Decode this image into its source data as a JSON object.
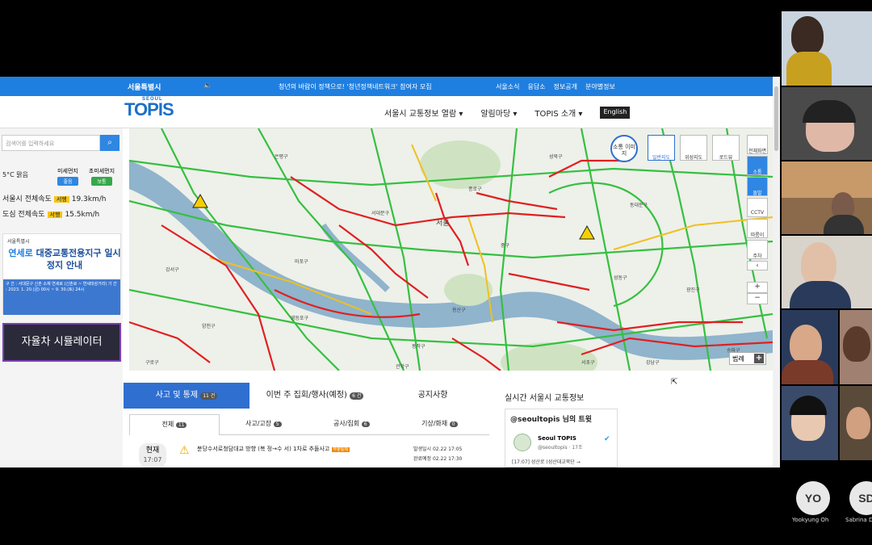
{
  "browser": {
    "topbar": {
      "logo": "서울특별시",
      "notice": "청년의 바람이 정책으로! '청년정책네트워크' 참여자 모집",
      "links": [
        "서울소식",
        "응답소",
        "정보공개",
        "분야별정보"
      ]
    },
    "nav": {
      "brand": "TOPIS",
      "brand_small": "SEOUL",
      "menu": [
        "서울시 교통정보 열람 ▾",
        "알림마당 ▾",
        "TOPIS 소개 ▾"
      ],
      "english": "English"
    },
    "left": {
      "search_placeholder": "검색어를 입력하세요",
      "weather": "5°C 맑음",
      "fine_dust_label": "미세먼지",
      "fine_dust_value": "좋음",
      "ultrafine_dust_label": "초미세먼지",
      "ultrafine_dust_value": "보통",
      "city_speed_label": "서울시 전체속도",
      "city_speed_tag": "서행",
      "city_speed_value": "19.3km/h",
      "downtown_speed_label": "도심 전체속도",
      "downtown_speed_tag": "서행",
      "downtown_speed_value": "15.5km/h",
      "banner1_org": "서울특별시",
      "banner1_title_highlight": "연세로",
      "banner1_title_rest": " 대중교통전용지구 일시정지 안내",
      "banner1_footer": "구 간 : 서대문구 신촌 소재 연세로 (신촌로 ~ 연세대삼거리) 기 간 : 2023. 1. 20.(금) 00시 ~ 9. 30.(토) 24시",
      "banner2": "자율차 시뮬레이터"
    },
    "map": {
      "buttons": [
        "소통 이미지",
        "일반지도",
        "위성지도",
        "로드뷰"
      ],
      "side_buttons": [
        "전체화면",
        "소통",
        "돌발",
        "CCTV",
        "따릉이",
        "주차",
        "‹",
        "+",
        "−"
      ],
      "labels": [
        "서울",
        "강서구",
        "양천구",
        "영등포구",
        "마포구",
        "용산구",
        "중구",
        "종로구",
        "서대문구",
        "동작구",
        "강남구",
        "서초구",
        "성동구",
        "광진구",
        "송파구",
        "은평구",
        "성북구",
        "동대문구",
        "관악구",
        "구로구"
      ],
      "legend": "범례"
    },
    "tabs": {
      "accident": "사고 및 통제",
      "accident_count": "11 건",
      "events": "이번 주 집회/행사(예정)",
      "events_count": "6 건",
      "notices": "공지사항"
    },
    "subtabs": {
      "all": "전체",
      "all_n": "11",
      "accident": "사고/고장",
      "accident_n": "5",
      "construction": "공사/집회",
      "construction_n": "6",
      "weather": "기상/화재",
      "weather_n": "0"
    },
    "incident": {
      "now": "현재",
      "time": "17:07",
      "text": "분당수서로청담대교 방향 (복 정→수 서) 1차로 추돌사고",
      "tag": "부분통제",
      "occurred": "발생일시 02.22 17:05",
      "expected": "완료예정 02.22 17:30"
    },
    "twitter": {
      "section_title": "실시간 서울시 교통정보",
      "header": "@seoultopis 님의 트윗",
      "name": "Seoul TOPIS",
      "handle": "@seoultopis · 17조",
      "body": "[17:07] 성산로 (성산대교북단 →"
    }
  },
  "participants": [
    {
      "initials": "YO",
      "name": "Yookyung Oh"
    },
    {
      "initials": "SD",
      "name": "Sabrina De"
    }
  ],
  "colors": {
    "brand_blue": "#1f7fe0",
    "congestion_red": "#e02020",
    "slow_yellow": "#f0c020",
    "free_green": "#35c040"
  }
}
